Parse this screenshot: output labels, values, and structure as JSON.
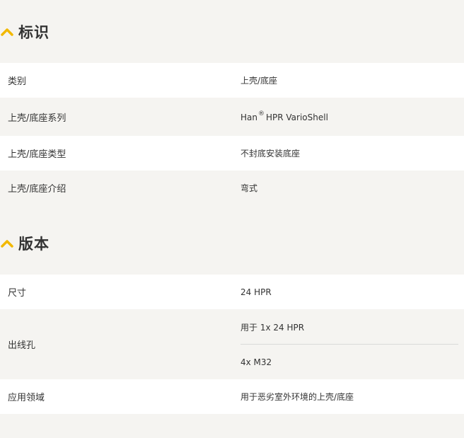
{
  "sections": [
    {
      "title": "标识",
      "rows": [
        {
          "label": "类别",
          "value": "上壳/底座"
        },
        {
          "label": "上壳/底座系列",
          "value_prefix": "Han",
          "value_mark": "®",
          "value_suffix": "HPR VarioShell"
        },
        {
          "label": "上壳/底座类型",
          "value": "不封底安装底座"
        },
        {
          "label": "上壳/底座介绍",
          "value": "弯式"
        }
      ]
    },
    {
      "title": "版本",
      "rows": [
        {
          "label": "尺寸",
          "value": "24 HPR"
        },
        {
          "label": "出线孔",
          "values": [
            "用于 1x 24 HPR",
            "4x M32"
          ]
        },
        {
          "label": "应用领域",
          "value": "用于恶劣室外环境的上壳/底座"
        }
      ]
    }
  ],
  "icons": {
    "section_toggle": "chevron-up-icon"
  },
  "colors": {
    "accent": "#f2b800",
    "row_white": "#ffffff",
    "row_grey": "#f5f4f1",
    "text": "#333333"
  }
}
